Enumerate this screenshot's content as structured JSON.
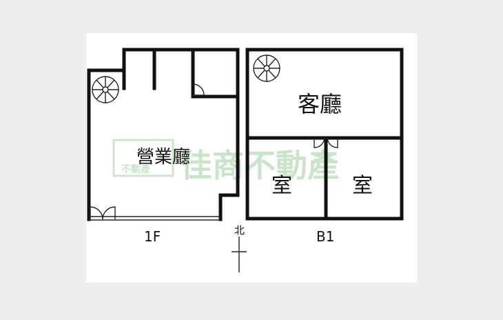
{
  "floor_1f": {
    "label": "1F",
    "room_main": "營業廳"
  },
  "floor_b1": {
    "label": "B1",
    "room_living": "客廳",
    "room_left": "室",
    "room_right": "室"
  },
  "compass": {
    "north": "北"
  },
  "watermark": {
    "text": "佳商不動產",
    "logo_text": "不動產"
  },
  "colors": {
    "background": "#eeeeee",
    "paper": "#ffffff",
    "wall": "#111111",
    "watermark": "#9fcf9f"
  }
}
